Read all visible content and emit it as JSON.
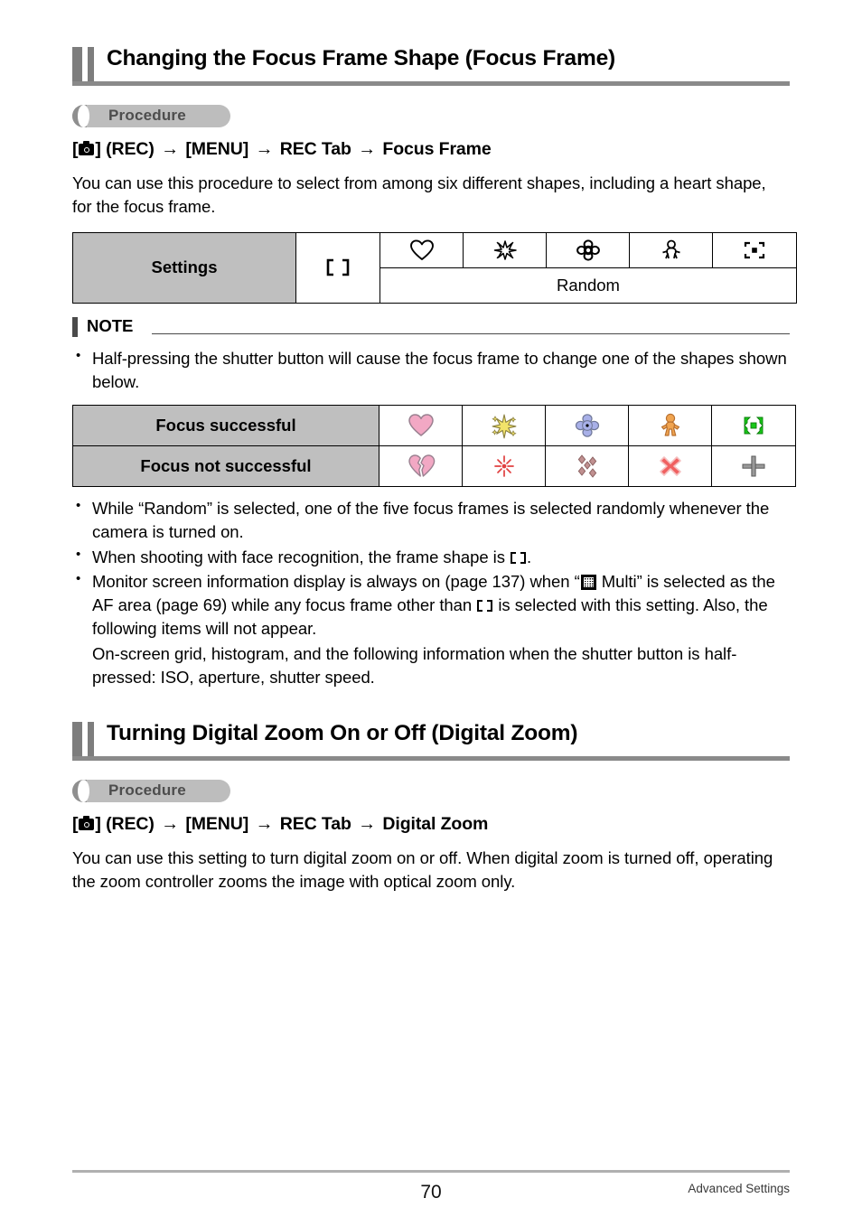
{
  "page": {
    "number": "70",
    "footer_caption": "Advanced Settings"
  },
  "sections": [
    {
      "title": "Changing the Focus Frame Shape (Focus Frame)",
      "procedure_label": "Procedure",
      "path": {
        "bracket_open": "[",
        "camera_icon": "camera-icon",
        "bracket_close": "] (REC)",
        "arrow1": "→",
        "menu": "[MENU]",
        "arrow2": "→",
        "tab": "REC Tab",
        "arrow3": "→",
        "target": "Focus Frame"
      },
      "body": "You can use this procedure to select from among six different shapes, including a heart shape, for the focus frame."
    },
    {
      "title": "Turning Digital Zoom On or Off (Digital Zoom)",
      "procedure_label": "Procedure",
      "path": {
        "bracket_open": "[",
        "camera_icon": "camera-icon",
        "bracket_close": "] (REC)",
        "arrow1": "→",
        "menu": "[MENU]",
        "arrow2": "→",
        "tab": "REC Tab",
        "arrow3": "→",
        "target": "Digital Zoom"
      },
      "body": "You can use this setting to turn digital zoom on or off. When digital zoom is turned off, operating the zoom controller zooms the image with optical zoom only."
    }
  ],
  "settings_table": {
    "row_label": "Settings",
    "default_icon": "focus-bracket-icon",
    "icons": [
      "heart-outline-icon",
      "sparkle-outline-icon",
      "flower-outline-icon",
      "teddy-bear-outline-icon",
      "dot-bracket-icon"
    ],
    "random_label": "Random"
  },
  "note": {
    "title": "NOTE",
    "bullets": [
      "Half-pressing the shutter button will cause the focus frame to change one of the shapes shown below."
    ]
  },
  "result_table": {
    "rows": [
      {
        "label": "Focus successful",
        "icons": [
          "heart-pink-icon",
          "sparkle-yellow-icon",
          "flower-blue-icon",
          "teddy-bear-orange-icon",
          "bracket-green-icon"
        ]
      },
      {
        "label": "Focus not successful",
        "icons": [
          "broken-heart-pink-icon",
          "burst-red-icon",
          "diamonds-brown-icon",
          "x-mark-red-icon",
          "plus-gray-icon"
        ]
      }
    ]
  },
  "notes_after_table": [
    {
      "segments": [
        {
          "type": "text",
          "value": "While “Random” is selected, one of the five focus frames is selected randomly whenever the camera is turned on."
        }
      ]
    },
    {
      "segments": [
        {
          "type": "text",
          "value": "When shooting with face recognition, the frame shape is "
        },
        {
          "type": "icon",
          "value": "focus-bracket-icon"
        },
        {
          "type": "text",
          "value": "."
        }
      ]
    },
    {
      "segments": [
        {
          "type": "text",
          "value": "Monitor screen information display is always on (page 137) when “"
        },
        {
          "type": "icon",
          "value": "multi-af-icon"
        },
        {
          "type": "text",
          "value": " Multi” is selected as the AF area (page 69) while any focus frame other than "
        },
        {
          "type": "icon",
          "value": "focus-bracket-icon"
        },
        {
          "type": "text",
          "value": " is selected with this setting. Also, the following items will not appear."
        }
      ]
    }
  ],
  "note_continuation": "On-screen grid, histogram, and the following information when the shutter button is half-pressed: ISO, aperture, shutter speed.",
  "colors": {
    "heading_bar": "#7d7d7d",
    "heading_rule": "#8a8a8a",
    "procedure_pill": "#bdbdbd",
    "procedure_tab": "#8f8f8f",
    "procedure_text": "#4d4d4d",
    "table_header_gray": "#bfbfbf",
    "note_bar": "#4a4a4a",
    "footer_rule": "#b0b0b0",
    "heart_pink": "#f2a8c4",
    "sparkle_yellow": "#f2e36a",
    "flower_blue": "#a8b0e8",
    "teddy_orange": "#f0a450",
    "bracket_green": "#18c818",
    "burst_red": "#e04040",
    "diamond_brown": "#c09090",
    "x_red": "#f06060",
    "plus_gray": "#9a9a9a"
  }
}
